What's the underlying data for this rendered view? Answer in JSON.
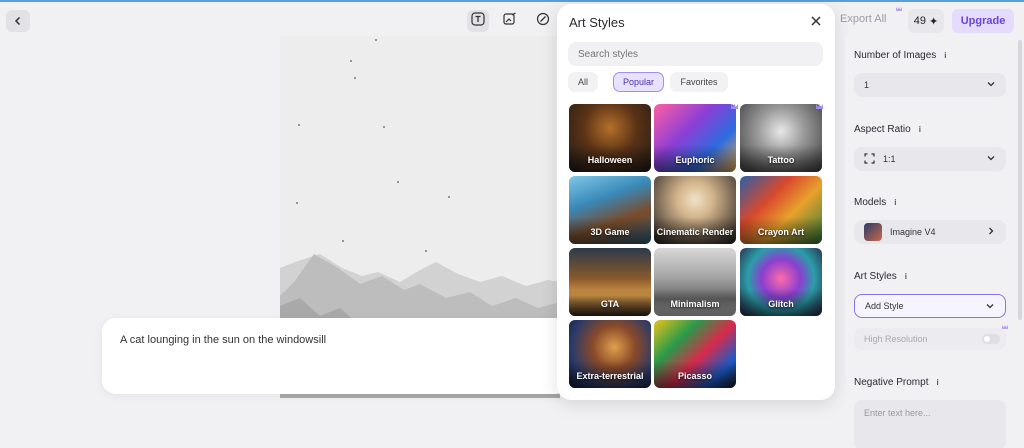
{
  "topbar": {
    "back_icon": "chevron-left-icon",
    "tools": [
      {
        "name": "text-tool-icon",
        "active": true
      },
      {
        "name": "edit-image-icon",
        "active": false
      },
      {
        "name": "brush-icon",
        "active": false
      }
    ],
    "export_label": "Export All",
    "credits": "49",
    "credits_icon": "sparkle-icon",
    "upgrade_label": "Upgrade"
  },
  "prompt": {
    "text": "A cat lounging in the sun on the windowsill"
  },
  "art_styles_panel": {
    "title": "Art Styles",
    "close_icon": "close-icon",
    "search_placeholder": "Search styles",
    "filters": [
      "All",
      "Popular",
      "Favorites"
    ],
    "active_filter": "Popular",
    "styles": [
      {
        "label": "Halloween",
        "premium": false
      },
      {
        "label": "Euphoric",
        "premium": true
      },
      {
        "label": "Tattoo",
        "premium": true
      },
      {
        "label": "3D Game",
        "premium": false
      },
      {
        "label": "Cinematic Render",
        "premium": false
      },
      {
        "label": "Crayon Art",
        "premium": false
      },
      {
        "label": "GTA",
        "premium": false
      },
      {
        "label": "Minimalism",
        "premium": false
      },
      {
        "label": "Glitch",
        "premium": false
      },
      {
        "label": "Extra-terrestrial",
        "premium": false
      },
      {
        "label": "Picasso",
        "premium": false
      }
    ]
  },
  "sidebar": {
    "number_of_images": {
      "label": "Number of Images",
      "value": "1"
    },
    "aspect_ratio": {
      "label": "Aspect Ratio",
      "value": "1:1"
    },
    "models": {
      "label": "Models",
      "value": "Imagine V4"
    },
    "art_styles": {
      "label": "Art Styles",
      "value": "Add Style"
    },
    "high_resolution": {
      "label": "High Resolution",
      "enabled": false
    },
    "negative_prompt": {
      "label": "Negative Prompt",
      "placeholder": "Enter text here..."
    }
  },
  "colors": {
    "accent": "#7c5ce0",
    "upgrade_bg": "#e4dbff",
    "premium_crown": "#a28cf0"
  }
}
